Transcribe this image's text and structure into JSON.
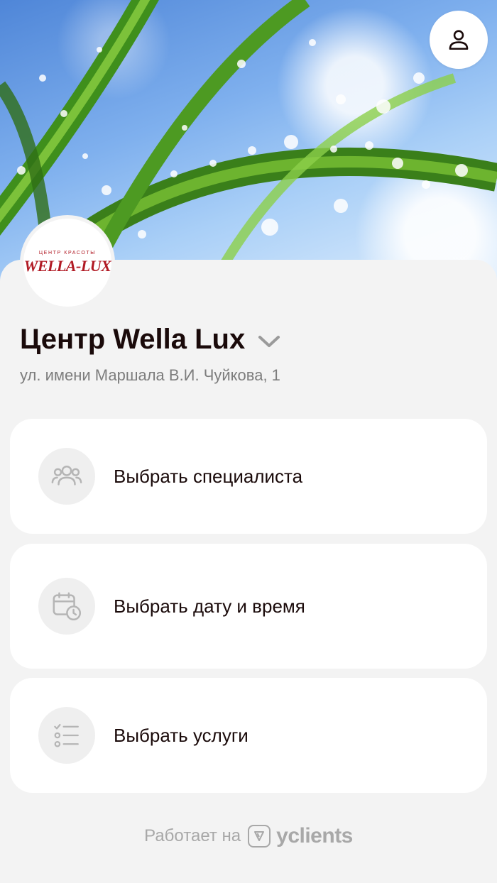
{
  "header": {
    "background_image": "grass-with-dew-drops",
    "profile_icon": "user-icon"
  },
  "salon": {
    "logo_top": "ЦЕНТР КРАСОТЫ",
    "logo_main": "WELLA-LUX",
    "name": "Центр Wella Lux",
    "address": "ул. имени Маршала В.И. Чуйкова, 1"
  },
  "actions": [
    {
      "label": "Выбрать специалиста",
      "icon": "users-icon"
    },
    {
      "label": "Выбрать дату и время",
      "icon": "calendar-clock-icon"
    },
    {
      "label": "Выбрать услуги",
      "icon": "checklist-icon"
    }
  ],
  "footer": {
    "powered_by": "Работает на",
    "brand": "yclients"
  },
  "colors": {
    "accent_logo": "#b11a24",
    "title": "#1a0a0a",
    "muted": "#7d7d7d",
    "background": "#f3f3f3"
  }
}
